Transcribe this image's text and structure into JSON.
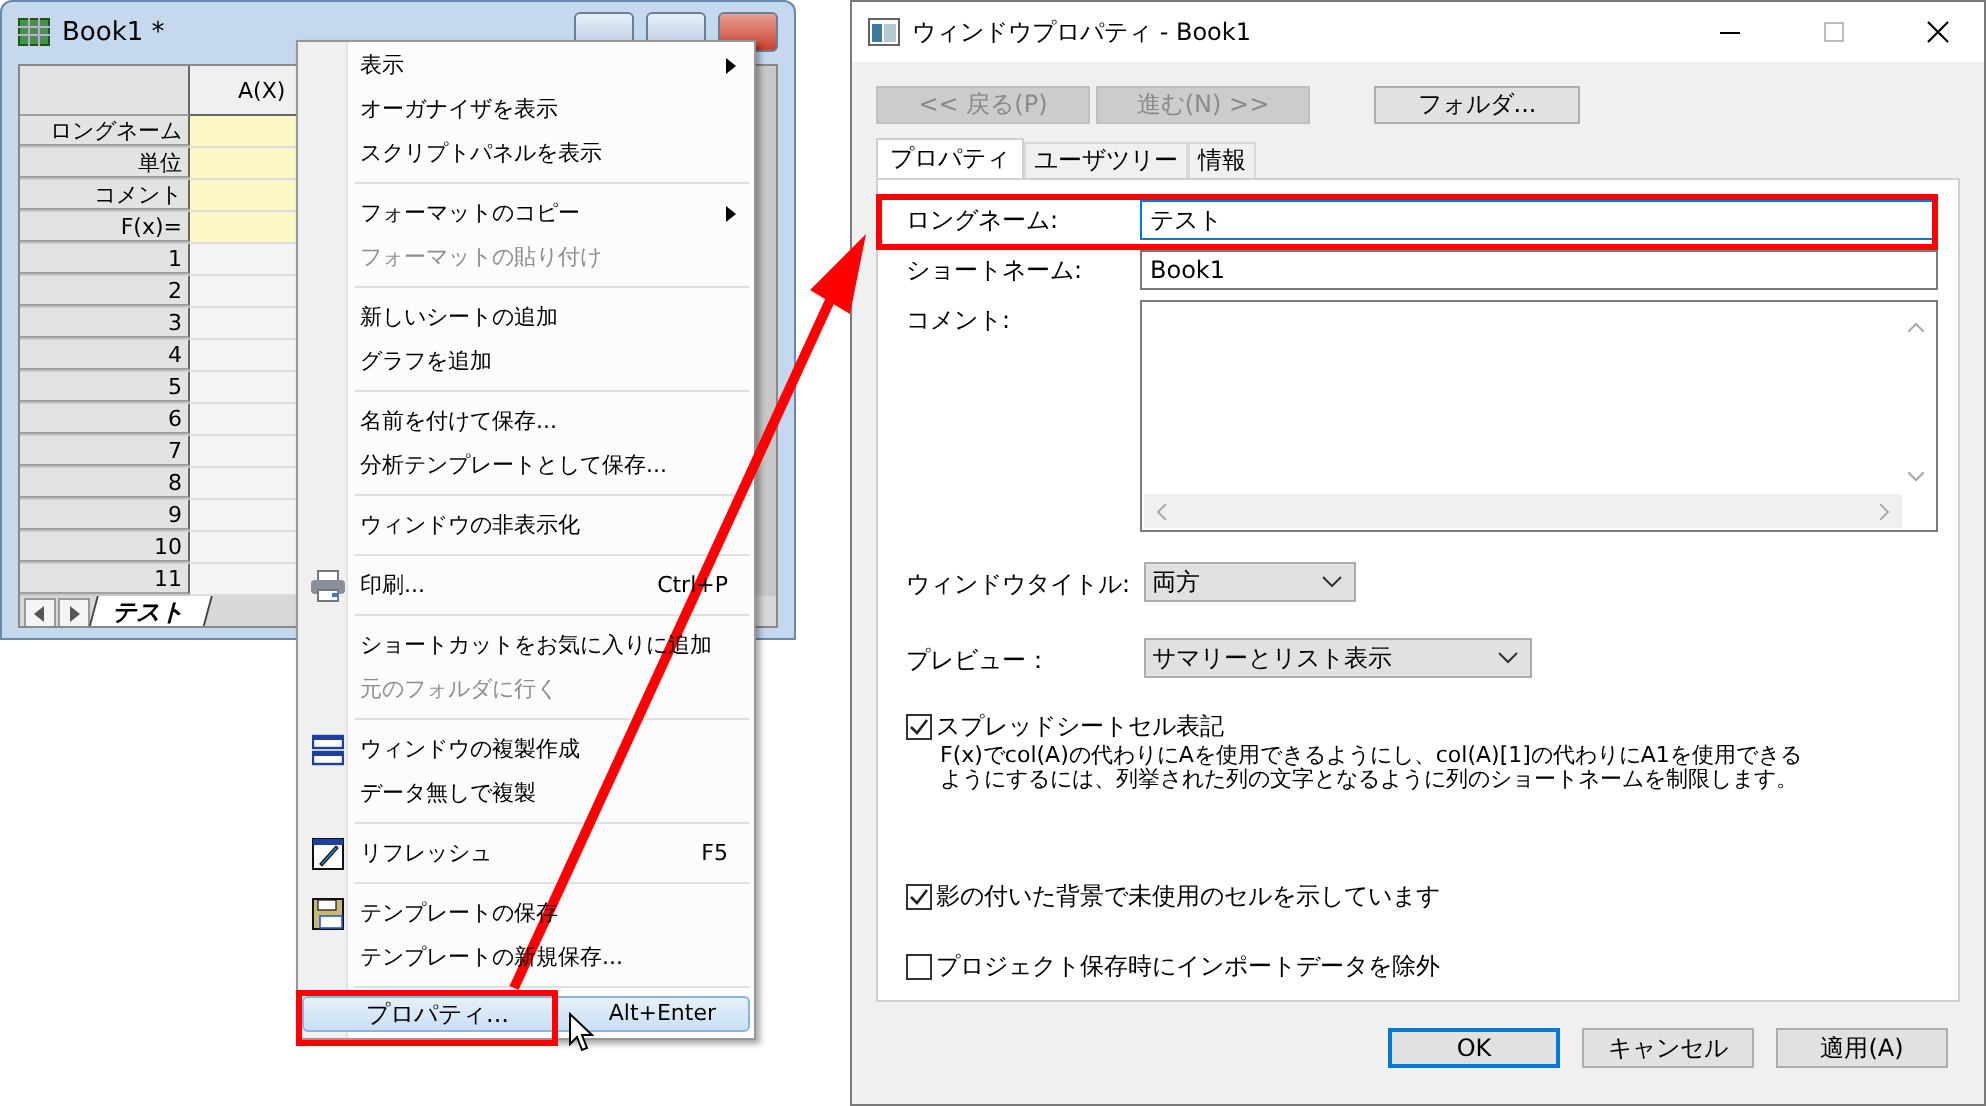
{
  "book_window": {
    "title": "Book1 *",
    "column_header": "A(X)",
    "label_rows": [
      "ロングネーム",
      "単位",
      "コメント",
      "F(x)="
    ],
    "row_numbers": [
      "1",
      "2",
      "3",
      "4",
      "5",
      "6",
      "7",
      "8",
      "9",
      "10",
      "11"
    ],
    "sheet_tab": "テスト"
  },
  "context_menu": {
    "groups": [
      [
        {
          "label": "表示",
          "submenu": true,
          "disabled": false,
          "selected": false
        },
        {
          "label": "オーガナイザを表示",
          "submenu": false,
          "disabled": false,
          "selected": false
        },
        {
          "label": "スクリプトパネルを表示",
          "submenu": false,
          "disabled": false,
          "selected": false
        }
      ],
      [
        {
          "label": "フォーマットのコピー",
          "submenu": true,
          "disabled": false,
          "selected": false
        },
        {
          "label": "フォーマットの貼り付け",
          "submenu": false,
          "disabled": true,
          "selected": false
        }
      ],
      [
        {
          "label": "新しいシートの追加",
          "submenu": false,
          "disabled": false,
          "selected": false
        },
        {
          "label": "グラフを追加",
          "submenu": false,
          "disabled": false,
          "selected": false
        }
      ],
      [
        {
          "label": "名前を付けて保存...",
          "submenu": false,
          "disabled": false,
          "selected": false
        },
        {
          "label": "分析テンプレートとして保存...",
          "submenu": false,
          "disabled": false,
          "selected": false
        }
      ],
      [
        {
          "label": "ウィンドウの非表示化",
          "submenu": false,
          "disabled": false,
          "selected": false
        }
      ],
      [
        {
          "label": "印刷...",
          "shortcut": "Ctrl+P",
          "submenu": false,
          "disabled": false,
          "selected": false
        }
      ],
      [
        {
          "label": "ショートカットをお気に入りに追加",
          "submenu": false,
          "disabled": false,
          "selected": false
        },
        {
          "label": "元のフォルダに行く",
          "submenu": false,
          "disabled": true,
          "selected": false
        }
      ],
      [
        {
          "label": "ウィンドウの複製作成",
          "submenu": false,
          "disabled": false,
          "selected": false
        },
        {
          "label": "データ無しで複製",
          "submenu": false,
          "disabled": false,
          "selected": false
        }
      ],
      [
        {
          "label": "リフレッシュ",
          "shortcut": "F5",
          "submenu": false,
          "disabled": false,
          "selected": false
        }
      ],
      [
        {
          "label": "テンプレートの保存",
          "submenu": false,
          "disabled": false,
          "selected": false
        },
        {
          "label": "テンプレートの新規保存...",
          "submenu": false,
          "disabled": false,
          "selected": false
        }
      ],
      [
        {
          "label": "プロパティ...",
          "shortcut": "Alt+Enter",
          "submenu": false,
          "disabled": false,
          "selected": true
        }
      ]
    ]
  },
  "dialog": {
    "title": "ウィンドウプロパティ - Book1",
    "nav_buttons": [
      {
        "label": "<< 戻る(P)",
        "disabled": true
      },
      {
        "label": "進む(N) >>",
        "disabled": true
      },
      {
        "label": "フォルダ...",
        "disabled": false
      }
    ],
    "tabs": [
      {
        "label": "プロパティ",
        "selected": true
      },
      {
        "label": "ユーザツリー",
        "selected": false
      },
      {
        "label": "情報",
        "selected": false
      }
    ],
    "fields": [
      {
        "kind": "text",
        "label": "ロングネーム:",
        "value": "テスト",
        "focused": true
      },
      {
        "kind": "text",
        "label": "ショートネーム:",
        "value": "Book1",
        "focused": false
      },
      {
        "kind": "textarea",
        "label": "コメント:"
      },
      {
        "kind": "select",
        "label": "ウィンドウタイトル:",
        "value": "両方"
      },
      {
        "kind": "select",
        "label": "プレビュー：",
        "value": "サマリーとリスト表示"
      }
    ],
    "checkboxes": [
      {
        "label": "スプレッドシートセル表記",
        "checked": true,
        "description": [
          "F(x)でcol(A)の代わりにAを使用できるようにし、col(A)[1]の代わりにA1を使用できる",
          "ようにするには、列挙された列の文字となるように列のショートネームを制限します。"
        ]
      },
      {
        "label": "影の付いた背景で未使用のセルを示しています",
        "checked": true
      },
      {
        "label": "プロジェクト保存時にインポートデータを除外",
        "checked": false
      }
    ],
    "buttons": [
      {
        "label": "OK",
        "default": true
      },
      {
        "label": "キャンセル",
        "default": false
      },
      {
        "label": "適用(A)",
        "default": false
      }
    ]
  }
}
